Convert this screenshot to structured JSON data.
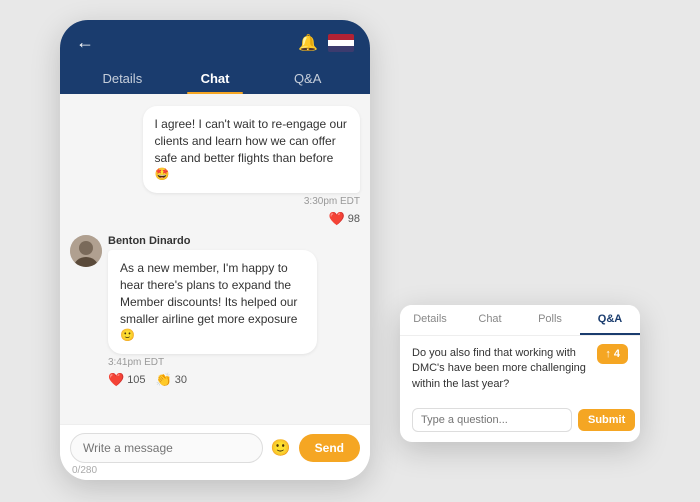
{
  "scene": {
    "background": "#e8e8e8"
  },
  "phone": {
    "tabs": [
      {
        "label": "Details",
        "active": false
      },
      {
        "label": "Chat",
        "active": true
      },
      {
        "label": "Q&A",
        "active": false
      }
    ],
    "messages": [
      {
        "type": "out",
        "text": "I agree! I can't wait to re-engage our clients and learn how we can offer safe and better flights than before 🤩",
        "time": "3:30pm EDT",
        "reactions": [
          {
            "emoji": "❤️",
            "count": "98"
          }
        ]
      },
      {
        "type": "in",
        "sender": "Benton Dinardo",
        "text": "As a new member, I'm happy to hear there's plans to expand the Member discounts! Its helped our smaller airline get more exposure 🙂",
        "time": "3:41pm EDT",
        "reactions": [
          {
            "emoji": "❤️",
            "count": "105"
          },
          {
            "emoji": "👏",
            "count": "30"
          }
        ]
      }
    ],
    "input": {
      "placeholder": "Write a message",
      "char_count": "0/280",
      "send_label": "Send"
    }
  },
  "overlay": {
    "tabs": [
      {
        "label": "Details",
        "active": false
      },
      {
        "label": "Chat",
        "active": false
      },
      {
        "label": "Polls",
        "active": false
      },
      {
        "label": "Q&A",
        "active": true
      }
    ],
    "question": "Do you also find that working with DMC's have been more challenging within the last year?",
    "upvote_count": "4",
    "input_placeholder": "Type a question...",
    "submit_label": "Submit"
  }
}
